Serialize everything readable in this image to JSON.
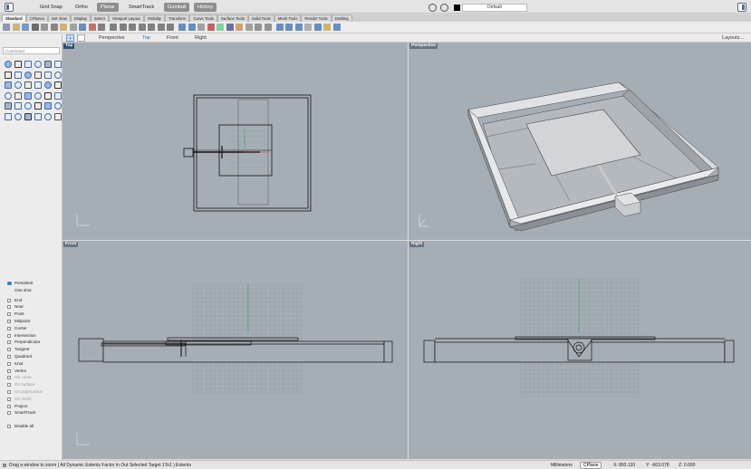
{
  "titlebar": {
    "toggles": [
      {
        "label": "Grid Snap",
        "on": false
      },
      {
        "label": "Ortho",
        "on": false
      },
      {
        "label": "Planar",
        "on": true
      },
      {
        "label": "SmartTrack",
        "on": false
      },
      {
        "label": "Gumball",
        "on": true
      },
      {
        "label": "History",
        "on": true
      }
    ],
    "layer": "Default"
  },
  "tabs": [
    "Standard",
    "CPlanes",
    "Set View",
    "Display",
    "Select",
    "Viewport Layout",
    "Visibility",
    "Transform",
    "Curve Tools",
    "Surface Tools",
    "Solid Tools",
    "Mesh Tools",
    "Render Tools",
    "Drafting"
  ],
  "viewport_tabs": [
    "Perspective",
    "Top",
    "Front",
    "Right"
  ],
  "active_viewport_tab": "Top",
  "layouts_label": "Layouts...",
  "command": {
    "placeholder": "Command"
  },
  "viewports": {
    "top": "Top",
    "perspective": "Perspective",
    "front": "Front",
    "right": "Right"
  },
  "osnap": {
    "mode": [
      {
        "label": "Persistent",
        "on": true
      },
      {
        "label": "One shot",
        "on": false
      }
    ],
    "snaps": [
      {
        "label": "End",
        "enabled": true
      },
      {
        "label": "Near",
        "enabled": true
      },
      {
        "label": "Point",
        "enabled": true
      },
      {
        "label": "Midpoint",
        "enabled": true
      },
      {
        "label": "Center",
        "enabled": true
      },
      {
        "label": "Intersection",
        "enabled": true
      },
      {
        "label": "Perpendicular",
        "enabled": true
      },
      {
        "label": "Tangent",
        "enabled": true
      },
      {
        "label": "Quadrant",
        "enabled": true
      },
      {
        "label": "Knot",
        "enabled": true
      },
      {
        "label": "Vertex",
        "enabled": true
      },
      {
        "label": "On curve",
        "enabled": false
      },
      {
        "label": "On surface",
        "enabled": false
      },
      {
        "label": "On polysurface",
        "enabled": false
      },
      {
        "label": "On mesh",
        "enabled": false
      },
      {
        "label": "Project",
        "enabled": true
      },
      {
        "label": "SmartTrack",
        "enabled": true
      }
    ],
    "disable_all": "Disable all"
  },
  "status": {
    "prompt": "Drag a window to zoom ( All Dynamic Extents Factor In Out Selected Target 1To1 ) Extents",
    "units": "Millimeters",
    "cplane": "CPlane",
    "x": "X: 893.120",
    "y": "Y: -663.078",
    "z": "Z: 0.000"
  },
  "colors": {
    "viewport_bg": "#a6aeb5",
    "accent": "#2f6fb4",
    "grid": "#8d959c"
  }
}
